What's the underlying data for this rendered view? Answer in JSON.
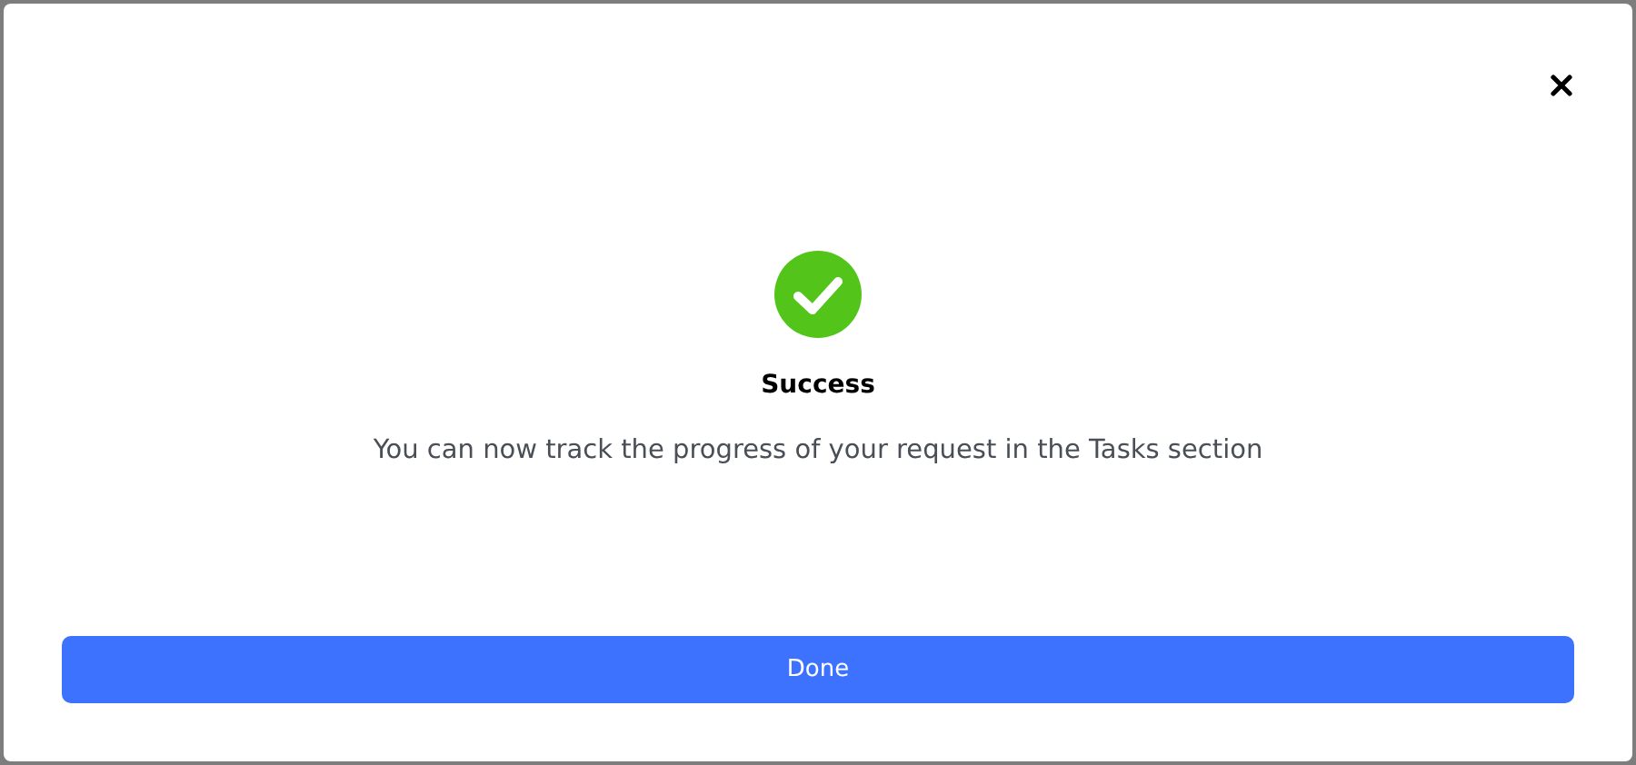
{
  "dialog": {
    "title": "Success",
    "message": "You can now track the progress of your request in the Tasks section",
    "button": "Done"
  }
}
